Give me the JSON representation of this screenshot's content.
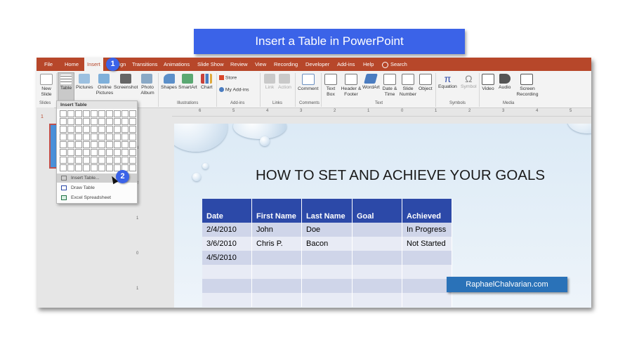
{
  "banner": {
    "title": "Insert a Table in PowerPoint"
  },
  "tabs": [
    "File",
    "Home",
    "Insert",
    "Design",
    "Transitions",
    "Animations",
    "Slide Show",
    "Review",
    "View",
    "Recording",
    "Developer",
    "Add-ins",
    "Help"
  ],
  "search_label": "Search",
  "ribbon": {
    "new_slide": "New Slide",
    "table": "Table",
    "pictures": "Pictures",
    "online_pictures": "Online Pictures",
    "screenshot": "Screenshot",
    "photo_album": "Photo Album",
    "shapes": "Shapes",
    "smartart": "SmartArt",
    "chart": "Chart",
    "store": "Store",
    "my_addins": "My Add-ins",
    "link": "Link",
    "action": "Action",
    "comment": "Comment",
    "text_box": "Text Box",
    "header_footer": "Header & Footer",
    "wordart": "WordArt",
    "date_time": "Date & Time",
    "slide_number": "Slide Number",
    "object": "Object",
    "equation": "Equation",
    "symbol": "Symbol",
    "video": "Video",
    "audio": "Audio",
    "screen_recording": "Screen Recording",
    "groups": {
      "slides": "Slides",
      "illustrations": "Illustrations",
      "addins": "Add-ins",
      "links": "Links",
      "comments": "Comments",
      "text": "Text",
      "symbols": "Symbols",
      "media": "Media"
    }
  },
  "ruler_numbers": [
    "6",
    "5",
    "4",
    "3",
    "2",
    "1",
    "0",
    "1",
    "2",
    "3",
    "4",
    "5",
    "6"
  ],
  "vruler_numbers": [
    "3",
    "2",
    "1",
    "0",
    "1"
  ],
  "thumb_number": "1",
  "dropdown": {
    "header": "Insert Table",
    "items": [
      "Insert Table...",
      "Draw Table",
      "Excel Spreadsheet"
    ]
  },
  "slide": {
    "title": "HOW TO SET AND ACHIEVE YOUR GOALS",
    "table": {
      "headers": [
        "Date",
        "First Name",
        "Last Name",
        "Goal",
        "Achieved"
      ],
      "rows": [
        [
          "2/4/2010",
          "John",
          "Doe",
          "",
          "In Progress"
        ],
        [
          "3/6/2010",
          "Chris P.",
          "Bacon",
          "",
          "Not Started"
        ],
        [
          "4/5/2010",
          "",
          "",
          "",
          ""
        ],
        [
          "",
          "",
          "",
          "",
          ""
        ],
        [
          "",
          "",
          "",
          "",
          ""
        ],
        [
          "",
          "",
          "",
          "",
          ""
        ]
      ]
    }
  },
  "watermark": "RaphaelChalvarian.com",
  "badges": [
    "1",
    "2"
  ],
  "colors": {
    "accent_orange": "#b7472a",
    "banner_blue": "#3b63e8",
    "table_header": "#2c49a8"
  }
}
